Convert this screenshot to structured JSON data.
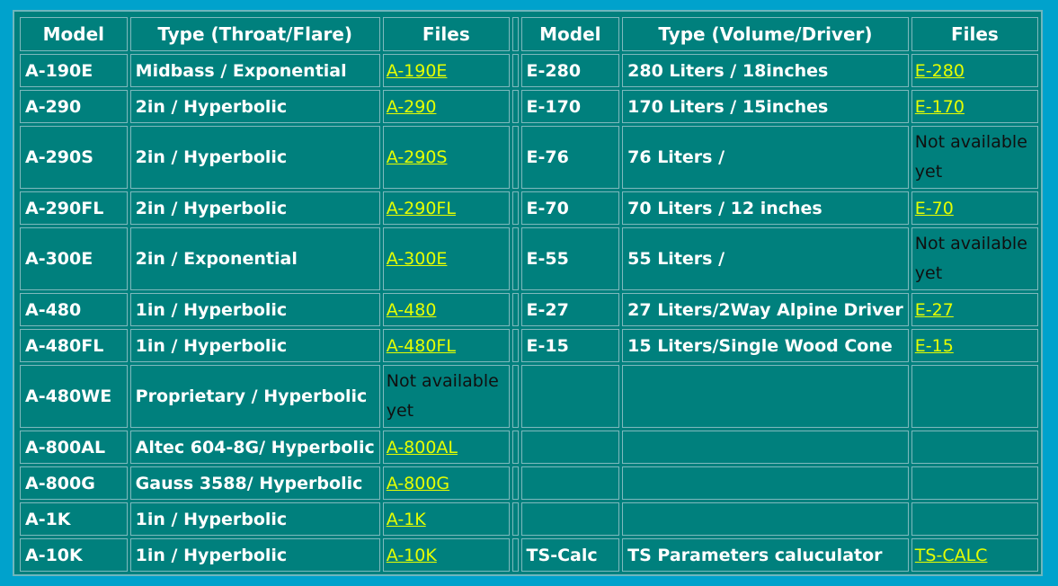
{
  "colors": {
    "page_background": "#00A2CC",
    "table_background": "#00807D",
    "border": "#7FB9BD",
    "text": "#FFFFFF",
    "link": "#E6FF00",
    "unavailable_text": "#101010"
  },
  "headers": {
    "left_model": "Model",
    "left_type": "Type (Throat/Flare)",
    "left_files": "Files",
    "right_model": "Model",
    "right_type": "Type (Volume/Driver)",
    "right_files": "Files"
  },
  "rows": [
    {
      "lm": "A-190E",
      "lt": "Midbass / Exponential",
      "lf": "A-190E",
      "lf_na": "",
      "rm": "E-280",
      "rt": "280 Liters / 18inches",
      "rf": "E-280",
      "rf_na": ""
    },
    {
      "lm": "A-290",
      "lt": "2in / Hyperbolic",
      "lf": "A-290",
      "lf_na": "",
      "rm": "E-170",
      "rt": "170 Liters / 15inches",
      "rf": "E-170",
      "rf_na": ""
    },
    {
      "lm": "A-290S",
      "lt": "2in / Hyperbolic",
      "lf": "A-290S",
      "lf_na": "",
      "rm": "E-76",
      "rt": "76 Liters /",
      "rf": "",
      "rf_na": "Not available yet"
    },
    {
      "lm": "A-290FL",
      "lt": "2in / Hyperbolic",
      "lf": "A-290FL",
      "lf_na": "",
      "rm": "E-70",
      "rt": "70 Liters / 12 inches",
      "rf": "E-70",
      "rf_na": ""
    },
    {
      "lm": "A-300E",
      "lt": "2in / Exponential",
      "lf": "A-300E",
      "lf_na": "",
      "rm": "E-55",
      "rt": "55 Liters /",
      "rf": "",
      "rf_na": "Not available yet"
    },
    {
      "lm": "A-480",
      "lt": "1in / Hyperbolic",
      "lf": "A-480",
      "lf_na": "",
      "rm": "E-27",
      "rt": "27 Liters/2Way Alpine Driver",
      "rf": "E-27",
      "rf_na": ""
    },
    {
      "lm": "A-480FL",
      "lt": "1in / Hyperbolic",
      "lf": "A-480FL",
      "lf_na": "",
      "rm": "E-15",
      "rt": "15 Liters/Single Wood Cone",
      "rf": "E-15",
      "rf_na": ""
    },
    {
      "lm": "A-480WE",
      "lt": "Proprietary / Hyperbolic",
      "lf": "",
      "lf_na": "Not available yet",
      "rm": "",
      "rt": "",
      "rf": "",
      "rf_na": ""
    },
    {
      "lm": "A-800AL",
      "lt": "Altec 604-8G/ Hyperbolic",
      "lf": "A-800AL",
      "lf_na": "",
      "rm": "",
      "rt": "",
      "rf": "",
      "rf_na": ""
    },
    {
      "lm": "A-800G",
      "lt": "Gauss 3588/ Hyperbolic",
      "lf": "A-800G",
      "lf_na": "",
      "rm": "",
      "rt": "",
      "rf": "",
      "rf_na": ""
    },
    {
      "lm": "A-1K",
      "lt": "1in / Hyperbolic",
      "lf": "A-1K",
      "lf_na": "",
      "rm": "",
      "rt": "",
      "rf": "",
      "rf_na": ""
    },
    {
      "lm": "A-10K",
      "lt": "1in / Hyperbolic",
      "lf": "A-10K",
      "lf_na": "",
      "rm": "TS-Calc",
      "rt": "TS Parameters caluculator",
      "rf": "TS-CALC",
      "rf_na": ""
    }
  ]
}
